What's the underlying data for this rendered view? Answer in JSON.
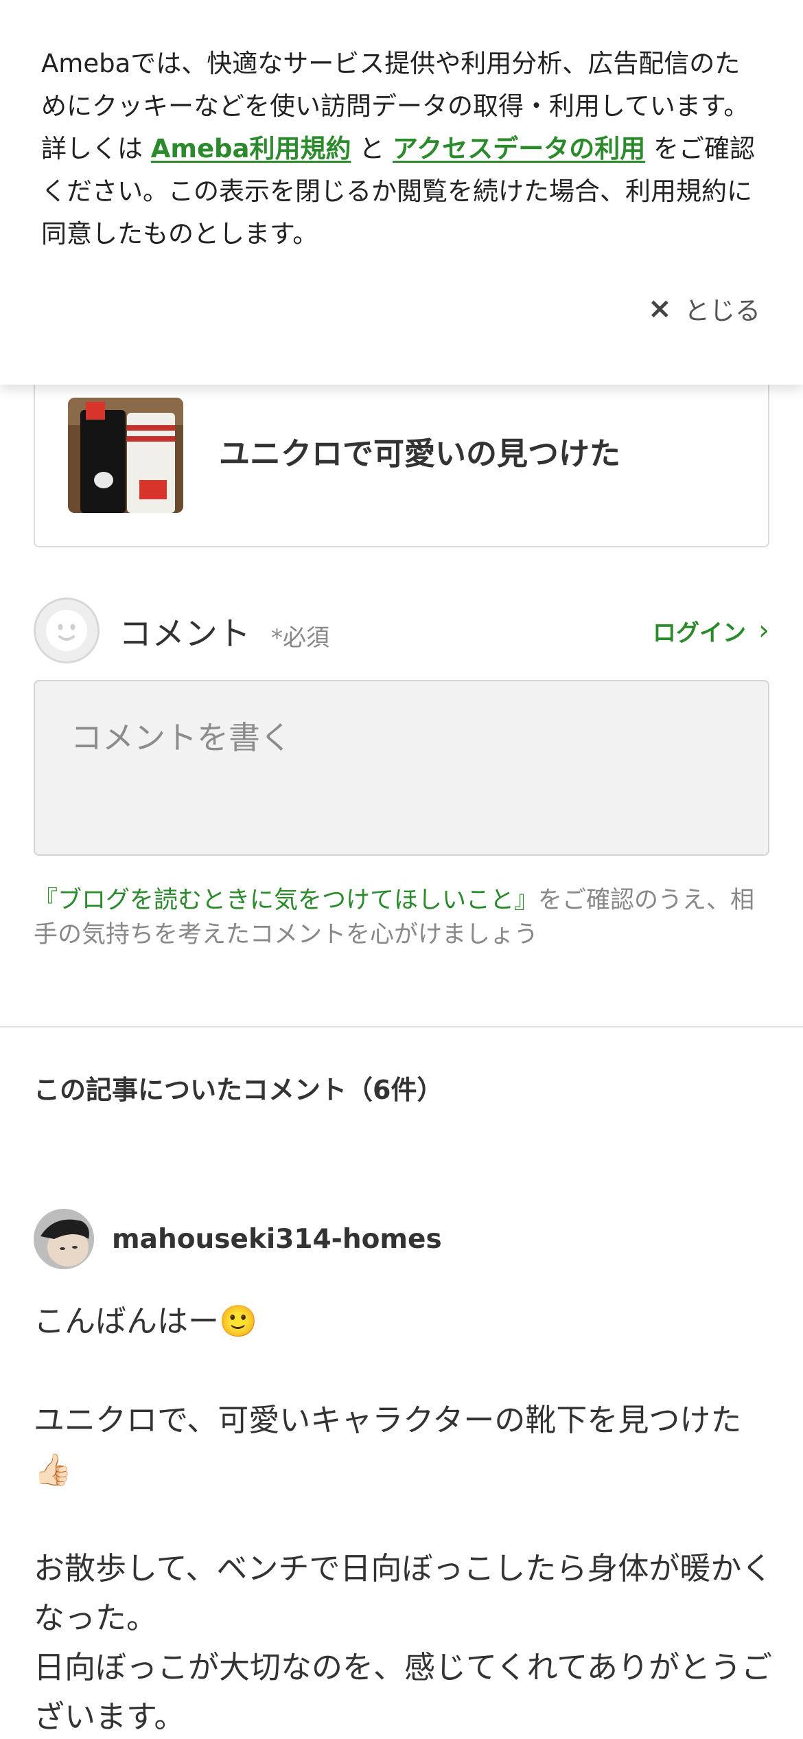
{
  "cookie_banner": {
    "text_before": "Amebaでは、快適なサービス提供や利用分析、広告配信のためにクッキーなどを使い訪問データの取得・利用しています。詳しくは ",
    "link_terms": "Ameba利用規約",
    "text_middle": " と ",
    "link_access": "アクセスデータの利用",
    "text_after": " をご確認ください。この表示を閉じるか閲覧を続けた場合、利用規約に同意したものとします。",
    "close_icon": "×",
    "close_label": "とじる"
  },
  "article_card": {
    "title": "ユニクロで可愛いの見つけた"
  },
  "comment_form": {
    "label": "コメント",
    "required": "*必須",
    "login": "ログイン",
    "placeholder": "コメントを書く",
    "guideline_link": "『ブログを読むときに気をつけてほしいこと』",
    "guideline_rest": "をご確認のうえ、相手の気持ちを考えたコメントを心がけましょう"
  },
  "comments_section": {
    "heading": "この記事についたコメント（6件）",
    "comments": [
      {
        "author": "mahouseki314-homes",
        "lines": [
          "こんばんはー🙂",
          "",
          "ユニクロで、可愛いキャラクターの靴下を見つけた👍🏻",
          "",
          "お散歩して、ベンチで日向ぼっこしたら身体が暖かくなった。",
          "日向ぼっこが大切なのを、感じてくれてありがとうございます。"
        ]
      }
    ]
  },
  "colors": {
    "accent_green": "#2b8a2b",
    "text": "#333333",
    "muted": "#888888"
  }
}
